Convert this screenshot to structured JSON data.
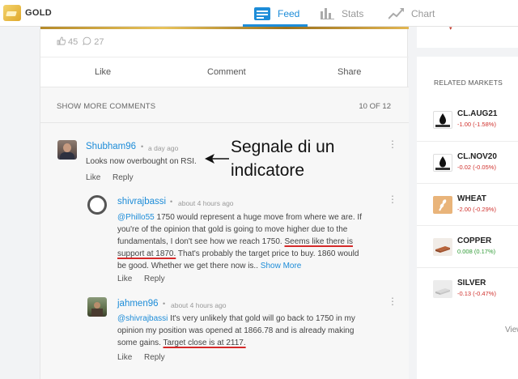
{
  "app": {
    "name": "GOLD"
  },
  "tabs": [
    {
      "label": "Feed",
      "icon": "feed-icon",
      "active": true
    },
    {
      "label": "Stats",
      "icon": "bar-chart-icon",
      "active": false
    },
    {
      "label": "Chart",
      "icon": "line-chart-icon",
      "active": false
    }
  ],
  "post": {
    "likes": "45",
    "comments": "27",
    "actions": {
      "like": "Like",
      "comment": "Comment",
      "share": "Share"
    }
  },
  "comments_header": {
    "show_more": "SHOW MORE COMMENTS",
    "count": "10 OF 12"
  },
  "comments": [
    {
      "user": "Shubham96",
      "time": "a day ago",
      "text": "Looks now overbought on RSI.",
      "like": "Like",
      "reply": "Reply"
    }
  ],
  "replies": [
    {
      "user": "shivrajbassi",
      "time": "about 4 hours ago",
      "mention": "@Phillo55",
      "text_a": " 1750 would represent a huge move from where we are. If you're of the opinion that gold is going to move higher due to the fundamentals, I don't see how we reach 1750. ",
      "text_underlined": "Seems like there is support at 1870.",
      "text_b": " That's probably the target price to buy. 1860 would be good. Whether we get there now is..",
      "show_more": "Show More",
      "like": "Like",
      "reply": "Reply"
    },
    {
      "user": "jahmen96",
      "time": "about 4 hours ago",
      "mention": "@shivrajbassi",
      "text_a": " It's very unlikely that gold will go back to 1750 in my opinion my position was opened at 1866.78 and is already making some gains. ",
      "text_underlined": "Target close is at 2117.",
      "like": "Like",
      "reply": "Reply"
    }
  ],
  "annotation": "Segnale di un indicatore",
  "related": {
    "title": "RELATED MARKETS",
    "items": [
      {
        "name": "CL.AUG21",
        "change": "-1.00 (-1.58%)",
        "direction": "down",
        "thumb": "oil-futures-icon"
      },
      {
        "name": "CL.NOV20",
        "change": "-0.02 (-0.05%)",
        "direction": "down",
        "thumb": "oil-futures-icon"
      },
      {
        "name": "WHEAT",
        "change": "-2.00 (-0.29%)",
        "direction": "down",
        "thumb": "wheat-icon"
      },
      {
        "name": "COPPER",
        "change": "0.008 (0.17%)",
        "direction": "up",
        "thumb": "copper-icon"
      },
      {
        "name": "SILVER",
        "change": "-0.13 (-0.47%)",
        "direction": "down",
        "thumb": "silver-icon"
      }
    ],
    "view_link": "View"
  },
  "colors": {
    "accent": "#1d8cd8",
    "negative": "#d0312d",
    "positive": "#2f9b35",
    "underline": "#d42a2a"
  }
}
